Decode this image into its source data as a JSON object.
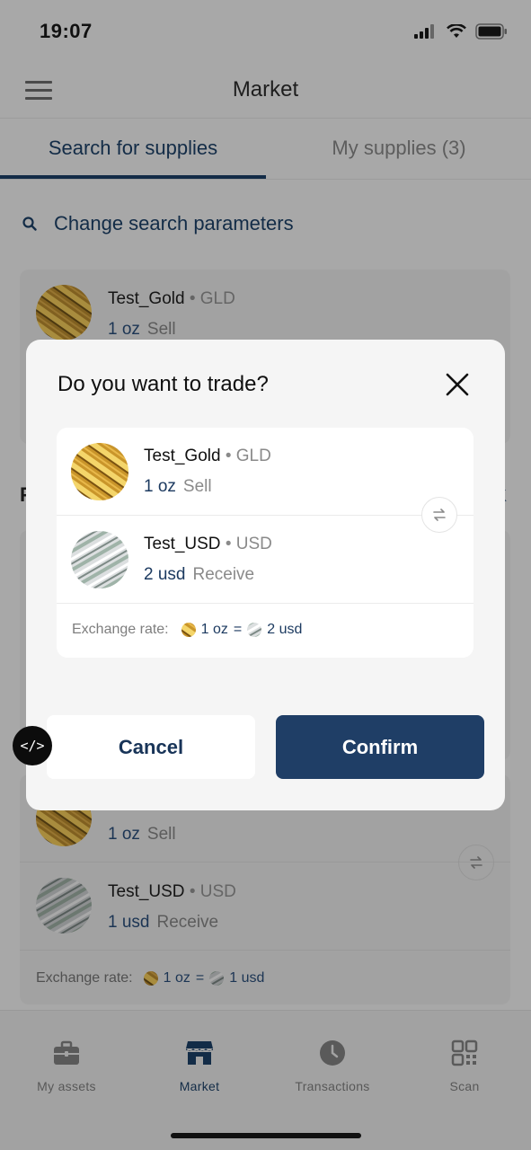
{
  "status_bar": {
    "time": "19:07"
  },
  "header": {
    "title": "Market"
  },
  "tabs": [
    {
      "label": "Search for supplies",
      "active": true
    },
    {
      "label": "My supplies (3)",
      "active": false
    }
  ],
  "search": {
    "label": "Change search parameters"
  },
  "background_card_top": {
    "name": "Test_Gold",
    "code": "GLD",
    "qty": "1 oz",
    "action": "Sell"
  },
  "background_card_bottom": {
    "row1": {
      "qty": "1 oz",
      "action": "Sell"
    },
    "row2": {
      "name": "Test_USD",
      "code": "USD",
      "qty": "1 usd",
      "action": "Receive"
    },
    "rate_label": "Exchange rate:",
    "rate_from": "1 oz",
    "rate_eq": "=",
    "rate_to": "1 usd"
  },
  "modal": {
    "title": "Do you want to trade?",
    "row1": {
      "name": "Test_Gold",
      "code": "GLD",
      "qty": "1 oz",
      "action": "Sell"
    },
    "row2": {
      "name": "Test_USD",
      "code": "USD",
      "qty": "2 usd",
      "action": "Receive"
    },
    "rate_label": "Exchange rate:",
    "rate_from": "1 oz",
    "rate_eq": "=",
    "rate_to": "2 usd",
    "cancel_label": "Cancel",
    "confirm_label": "Confirm"
  },
  "dev_badge": "</>",
  "bottom_nav": [
    {
      "label": "My assets",
      "icon": "briefcase-icon"
    },
    {
      "label": "Market",
      "icon": "store-icon",
      "active": true
    },
    {
      "label": "Transactions",
      "icon": "clock-icon"
    },
    {
      "label": "Scan",
      "icon": "qr-icon"
    }
  ],
  "colors": {
    "primary": "#1f3e66",
    "accent_text": "#1c3a60",
    "modal_bg": "#f5f5f5",
    "overlay": "#a8a8a8"
  }
}
